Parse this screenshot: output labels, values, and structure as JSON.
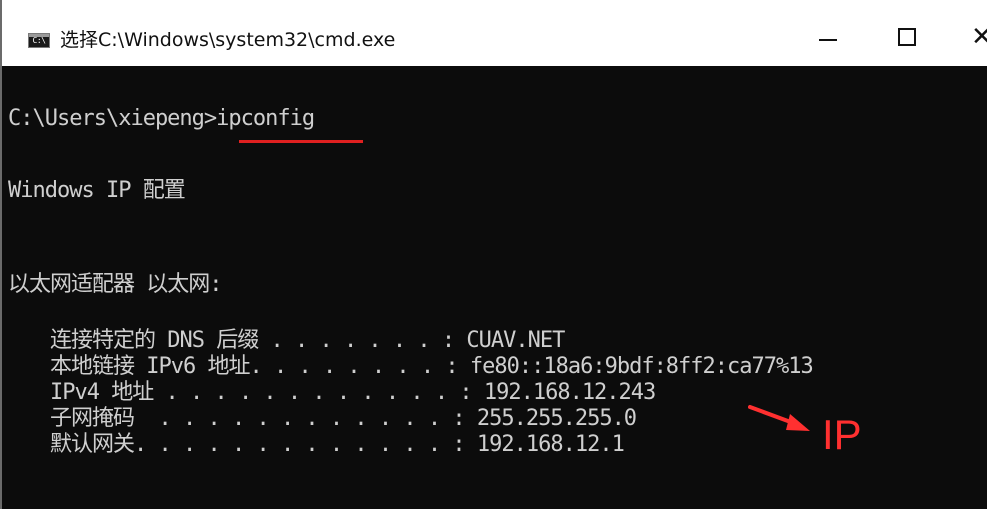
{
  "window": {
    "title": "选择C:\\Windows\\system32\\cmd.exe",
    "icon_name": "cmd-icon",
    "icon_text": "C:\\",
    "controls": {
      "minimize": "minimize-icon",
      "maximize": "maximize-icon",
      "close": "close-icon"
    }
  },
  "console": {
    "prompt": "C:\\Users\\xiepeng>",
    "command": "ipconfig",
    "header": "Windows IP 配置",
    "adapter": "以太网适配器 以太网:",
    "entries": [
      {
        "label": "连接特定的 DNS 后缀 . . . . . . . :",
        "value": " CUAV.NET"
      },
      {
        "label": "本地链接 IPv6 地址. . . . . . . . :",
        "value": " fe80::18a6:9bdf:8ff2:ca77%13"
      },
      {
        "label": "IPv4 地址 . . . . . . . . . . . . :",
        "value": " 192.168.12.243"
      },
      {
        "label": "子网掩码  . . . . . . . . . . . . :",
        "value": " 255.255.255.0"
      },
      {
        "label": "默认网关. . . . . . . . . . . . . :",
        "value": " 192.168.12.1"
      }
    ]
  },
  "annotation": {
    "label": "IP",
    "color": "#ff3030",
    "underline_color": "#e02020"
  },
  "colors": {
    "console_bg": "#0c0c0c",
    "console_text": "#cfcfcf",
    "titlebar_bg": "#ffffff"
  }
}
